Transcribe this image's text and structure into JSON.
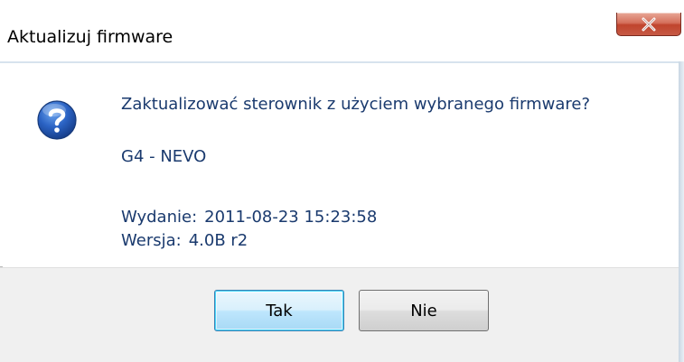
{
  "window": {
    "title": "Aktualizuj firmware",
    "close_icon": "close-icon"
  },
  "message": {
    "icon": "question-icon",
    "question": "Zaktualizować sterownik z użyciem wybranego firmware?",
    "device": "G4 - NEVO",
    "release_label": "Wydanie:",
    "release_value": "2011-08-23 15:23:58",
    "version_label": "Wersja:",
    "version_value": "4.0B r2"
  },
  "buttons": {
    "yes": "Tak",
    "no": "Nie"
  },
  "colors": {
    "message_text": "#1a3a6e",
    "footer_bg": "#f0f0f0",
    "default_button_border": "#3c7fb1",
    "close_button": "#c0442d"
  }
}
